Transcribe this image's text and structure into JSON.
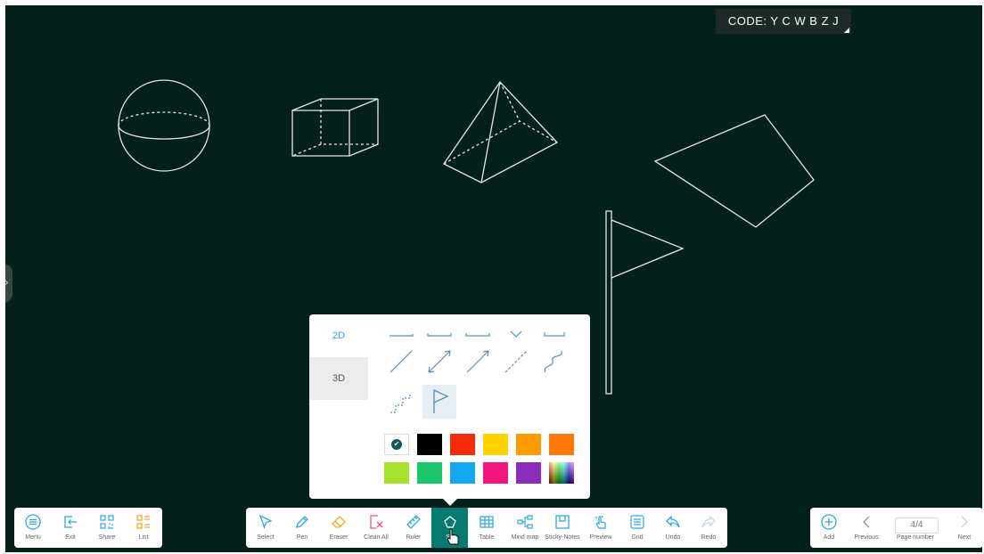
{
  "room": {
    "code_label": "CODE: Y C W B Z J"
  },
  "popup": {
    "tabs": [
      {
        "label": "2D"
      },
      {
        "label": "3D"
      }
    ],
    "colors": [
      "#ffffff",
      "#000000",
      "#f52b0a",
      "#ffd200",
      "#ff9a00",
      "#ff7a0a",
      "#a6e22e",
      "#19c76a",
      "#13a7f0",
      "#f2157e",
      "#8b2dba",
      "rainbow"
    ],
    "selected_color": "#ffffff"
  },
  "toolbar_left": {
    "items": [
      {
        "label": "Menu",
        "icon": "menu-icon"
      },
      {
        "label": "Exit",
        "icon": "exit-icon"
      },
      {
        "label": "Share",
        "icon": "qr-code-icon"
      },
      {
        "label": "List",
        "icon": "list-icon"
      }
    ]
  },
  "toolbar_main": {
    "items": [
      {
        "label": "Select",
        "icon": "cursor-icon"
      },
      {
        "label": "Pen",
        "icon": "pen-icon"
      },
      {
        "label": "Eraser",
        "icon": "eraser-icon"
      },
      {
        "label": "Clean All",
        "icon": "clear-all-icon"
      },
      {
        "label": "Ruler",
        "icon": "ruler-icon"
      },
      {
        "label": "Sh",
        "icon": "shapes-icon"
      },
      {
        "label": "Table",
        "icon": "table-icon"
      },
      {
        "label": "Mind map",
        "icon": "mind-map-icon"
      },
      {
        "label": "Sticky-Notes",
        "icon": "sticky-note-icon"
      },
      {
        "label": "Preview",
        "icon": "preview-hand-icon"
      },
      {
        "label": "Grid",
        "icon": "grid-icon"
      },
      {
        "label": "Undo",
        "icon": "undo-icon"
      },
      {
        "label": "Redo",
        "icon": "redo-icon"
      }
    ],
    "active": "Sh"
  },
  "toolbar_right": {
    "items": [
      {
        "label": "Add",
        "icon": "add-icon"
      },
      {
        "label": "Previous",
        "icon": "chevron-left-icon"
      },
      {
        "label": "Page number",
        "icon": ""
      },
      {
        "label": "Next",
        "icon": "chevron-right-icon"
      }
    ],
    "page_value": "4/4"
  },
  "colors": {
    "board": "#04201a",
    "accent_teal": "#087a70",
    "icon_blue": "#2ea8e0",
    "icon_orange": "#f5a623"
  }
}
